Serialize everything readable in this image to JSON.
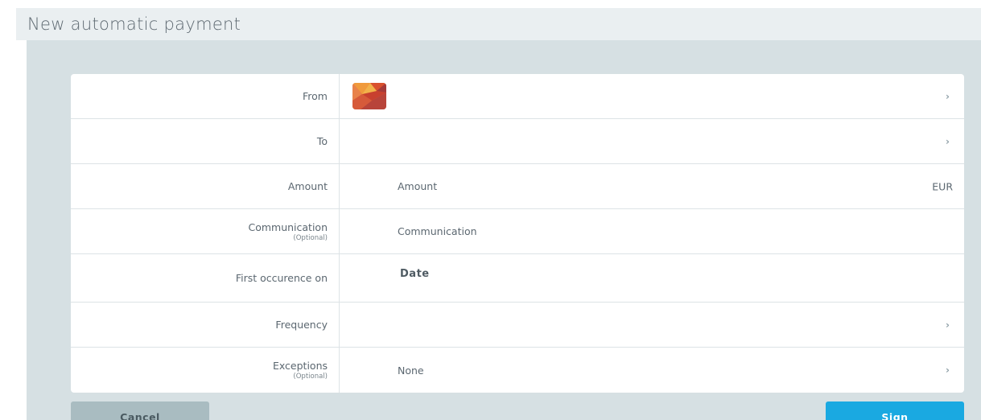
{
  "page": {
    "title": "New automatic payment"
  },
  "form": {
    "from": {
      "label": "From"
    },
    "to": {
      "label": "To"
    },
    "amount": {
      "label": "Amount",
      "placeholder": "Amount",
      "currency": "EUR"
    },
    "communication": {
      "label": "Communication",
      "optional": "(Optional)",
      "placeholder": "Communication"
    },
    "first_occurrence": {
      "label": "First occurence on",
      "value": "Date"
    },
    "frequency": {
      "label": "Frequency"
    },
    "exceptions": {
      "label": "Exceptions",
      "optional": "(Optional)",
      "value": "None"
    }
  },
  "icons": {
    "chevron": "›"
  },
  "actions": {
    "cancel_label": "Cancel",
    "sign_label": "Sign"
  },
  "colors": {
    "accent": "#1aa9e1",
    "cancel": "#a9bcc1",
    "background": "#d6e0e3"
  }
}
